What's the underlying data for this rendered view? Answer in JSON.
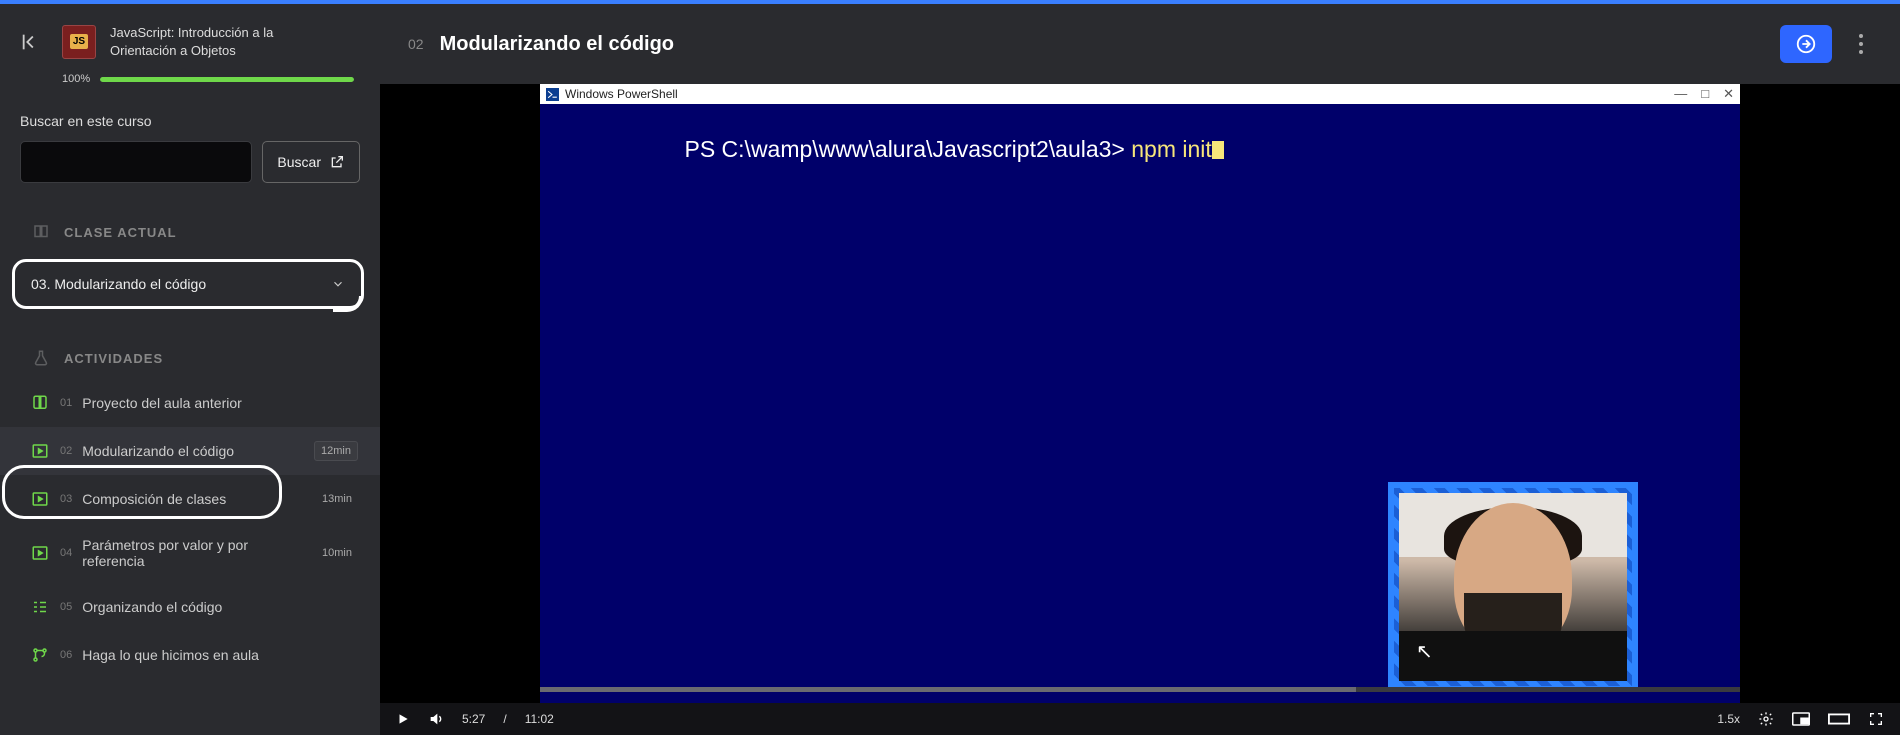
{
  "course": {
    "title": "JavaScript: Introducción a la Orientación a Objetos",
    "progress_pct": "100%",
    "progress_value": 100
  },
  "search": {
    "label": "Buscar en este curso",
    "button": "Buscar",
    "value": ""
  },
  "sections": {
    "current_class_header": "CLASE ACTUAL",
    "activities_header": "ACTIVIDADES"
  },
  "current_class": {
    "label": "03. Modularizando el código"
  },
  "activities": [
    {
      "num": "01",
      "label": "Proyecto del aula anterior",
      "icon": "book",
      "duration": ""
    },
    {
      "num": "02",
      "label": "Modularizando el código",
      "icon": "video",
      "duration": "12min",
      "current": true
    },
    {
      "num": "03",
      "label": "Composición de clases",
      "icon": "video",
      "duration": "13min"
    },
    {
      "num": "04",
      "label": "Parámetros por valor y por referencia",
      "icon": "video",
      "duration": "10min"
    },
    {
      "num": "05",
      "label": "Organizando el código",
      "icon": "list"
    },
    {
      "num": "06",
      "label": "Haga lo que hicimos en aula",
      "icon": "branch"
    }
  ],
  "header": {
    "num": "02",
    "title": "Modularizando el código"
  },
  "video": {
    "window_title": "Windows PowerShell",
    "prompt": "PS C:\\wamp\\www\\alura\\Javascript2\\aula3> ",
    "command": "npm init"
  },
  "player": {
    "current_time": "5:27",
    "total_time": "11:02",
    "time_sep": " / ",
    "speed": "1.5x",
    "played_pct": 48,
    "buffer_pct": 68
  }
}
